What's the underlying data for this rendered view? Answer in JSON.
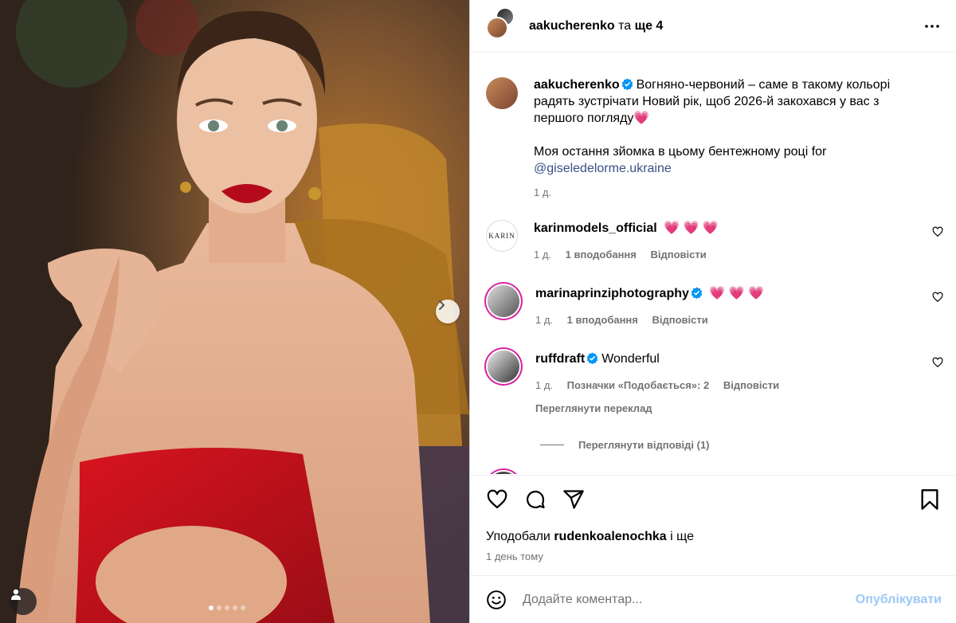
{
  "header": {
    "username": "aakucherenko",
    "coauthors_text": "та",
    "coauthors_count": "ще 4"
  },
  "caption": {
    "username": "aakucherenko",
    "text_line1": "Вогняно-червоний – саме в такому кольорі радять зустрічати Новий рік, щоб 2026-й закохався у вас з першого погляду",
    "emoji": "💗",
    "text_line2": "Моя остання зйомка в цьому бентежному році for",
    "mention": "@giseledelorme.ukraine",
    "time": "1 д."
  },
  "comments": [
    {
      "username": "karinmodels_official",
      "text": "💗 💗 💗",
      "verified": false,
      "time": "1 д.",
      "likes": "1 вподобання",
      "reply": "Відповісти",
      "avatar_label": "KARIN"
    },
    {
      "username": "marinaprinziphotography",
      "text": "💗 💗 💗",
      "verified": true,
      "time": "1 д.",
      "likes": "1 вподобання",
      "reply": "Відповісти"
    },
    {
      "username": "ruffdraft",
      "text": "Wonderful",
      "verified": true,
      "time": "1 д.",
      "likes": "Позначки «Подобається»: 2",
      "reply": "Відповісти",
      "see_translation": "Переглянути переклад",
      "view_replies": "Переглянути відповіді (1)"
    }
  ],
  "actions": {
    "liked_by_prefix": "Уподобали",
    "liked_by_user": "rudenkoalenochka",
    "liked_by_suffix": "і ще",
    "post_time": "1 день тому"
  },
  "add_comment": {
    "placeholder": "Додайте коментар...",
    "publish_label": "Опублікувати"
  },
  "carousel": {
    "slide_count": 5,
    "active_index": 0
  },
  "colors": {
    "accent": "#0095f6",
    "verified": "#0095f6",
    "muted": "#737373",
    "dress": "#c8101c"
  }
}
